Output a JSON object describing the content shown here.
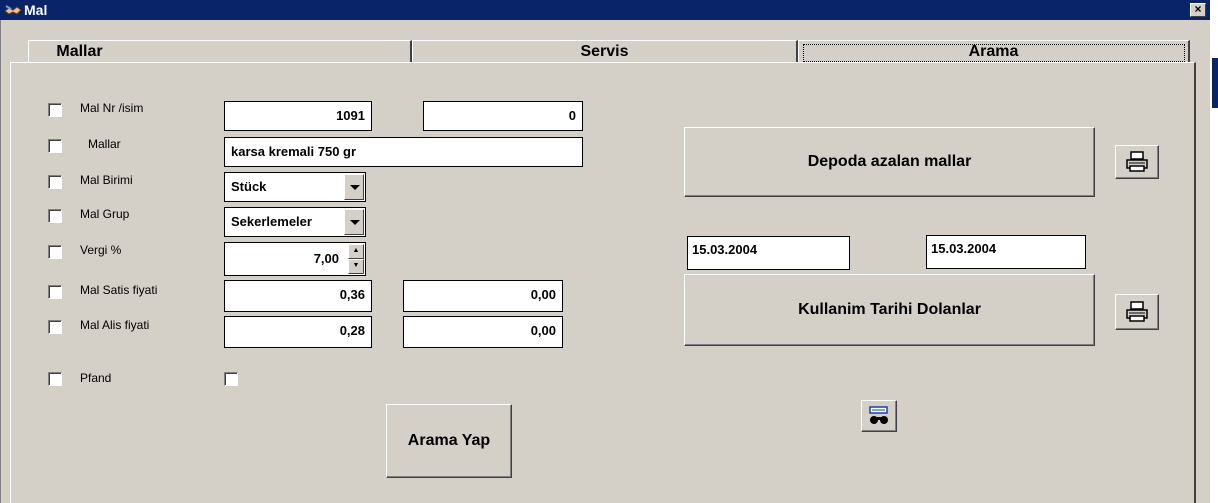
{
  "window": {
    "title": "Mal",
    "close_label": "×"
  },
  "tabs": [
    {
      "label": "Mallar"
    },
    {
      "label": "Servis"
    },
    {
      "label": "Arama"
    }
  ],
  "form": {
    "mal_nr_label": "Mal Nr /isim",
    "mal_nr_value": "1091",
    "mal_nr_value2": "0",
    "mallar_label": "Mallar",
    "mallar_value": "karsa kremali 750 gr",
    "birim_label": "Mal Birimi",
    "birim_value": "Stück",
    "grup_label": "Mal Grup",
    "grup_value": "Sekerlemeler",
    "vergi_label": "Vergi %",
    "vergi_value": "7,00",
    "satis_label": "Mal Satis fiyati",
    "satis_value": "0,36",
    "satis_value2": "0,00",
    "alis_label": "Mal Alis fiyati",
    "alis_value": "0,28",
    "alis_value2": "0,00",
    "pfand_label": "Pfand"
  },
  "buttons": {
    "arama_yap": "Arama Yap",
    "depoda": "Depoda  azalan mallar",
    "kullanim": "Kullanim Tarihi Dolanlar"
  },
  "dates": {
    "from": "15.03.2004",
    "to": "15.03.2004"
  },
  "icons": {
    "printer": "printer-icon",
    "search": "binoculars-icon",
    "app": "handshake-icon"
  }
}
